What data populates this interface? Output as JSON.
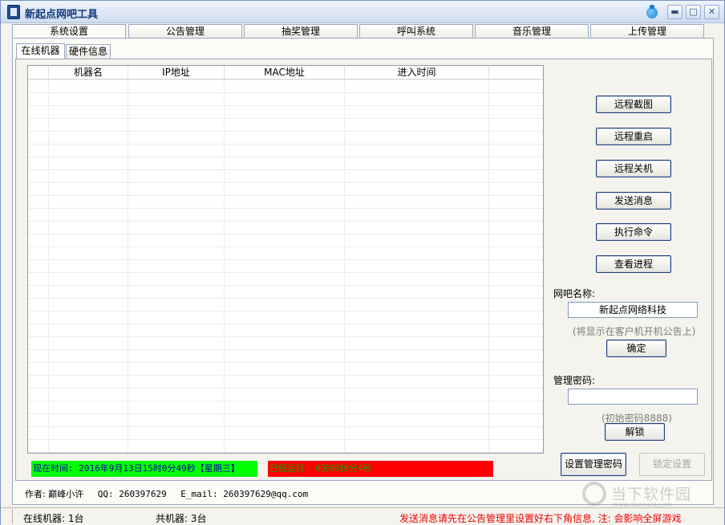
{
  "window": {
    "title": "新起点网吧工具"
  },
  "title_buttons": {
    "minimize": "▬",
    "maximize": "□",
    "close": "✕"
  },
  "main_tabs": [
    "系统设置",
    "公告管理",
    "抽奖管理",
    "呼叫系统",
    "音乐管理",
    "上传管理"
  ],
  "sub_tabs": [
    "在线机器",
    "硬件信息"
  ],
  "table": {
    "columns": [
      "机器名",
      "IP地址",
      "MAC地址",
      "进入时间"
    ]
  },
  "actions": {
    "screenshot": "远程截图",
    "reboot": "远程重启",
    "shutdown": "远程关机",
    "send_message": "发送消息",
    "run_command": "执行命令",
    "view_process": "查看进程"
  },
  "cafe_name": {
    "label": "网吧名称:",
    "value": "新起点网络科技",
    "hint": "(将显示在客户机开机公告上)",
    "confirm": "确定"
  },
  "admin_password": {
    "label": "管理密码:",
    "value": "",
    "hint": "(初始密码8888)",
    "unlock": "解锁",
    "set_password": "设置管理密码",
    "lock_settings": "锁定设置"
  },
  "status": {
    "current_time": "现在时间: 2016年9月13日15时0分49秒【星期三】",
    "running": "已经运行: 0天0时0分4秒"
  },
  "author": {
    "name": "作者: 巅峰小许",
    "qq": "QQ: 260397629",
    "email": "E_mail: 260397629@qq.com"
  },
  "statusbar": {
    "online": "在线机器: 1台",
    "total": "共机器: 3台",
    "notice": "发送消息请先在公告管理里设置好右下角信息, 注: 会影响全屏游戏"
  },
  "watermark": {
    "text": "当下软件园",
    "url": "www.downxia.com"
  },
  "colors": {
    "status_green": "#00ff00",
    "status_red": "#ff0000",
    "title_text": "#103a7a"
  },
  "icons": [
    "app-icon",
    "ie-icon",
    "minimize-icon",
    "maximize-icon",
    "close-icon"
  ]
}
